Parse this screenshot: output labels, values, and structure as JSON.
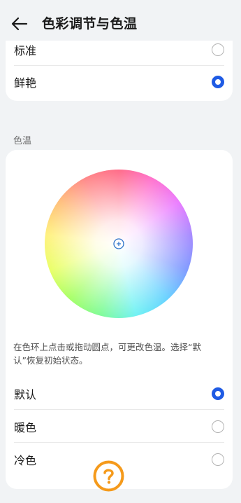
{
  "header": {
    "title": "色彩调节与色温",
    "back_icon": "arrow-left-icon"
  },
  "color_mode": {
    "options": [
      {
        "label": "标准",
        "selected": false
      },
      {
        "label": "鲜艳",
        "selected": true
      }
    ]
  },
  "color_temp": {
    "section_label": "色温",
    "description": "在色环上点击或拖动圆点，可更改色温。选择“默认”恢复初始状态。",
    "options": [
      {
        "label": "默认",
        "selected": true
      },
      {
        "label": "暖色",
        "selected": false
      },
      {
        "label": "冷色",
        "selected": false
      }
    ]
  },
  "colors": {
    "accent": "#1f5be4",
    "fab": "#f59a1b",
    "background": "#f1f3f5"
  },
  "help_fab": {
    "icon": "question-icon"
  }
}
